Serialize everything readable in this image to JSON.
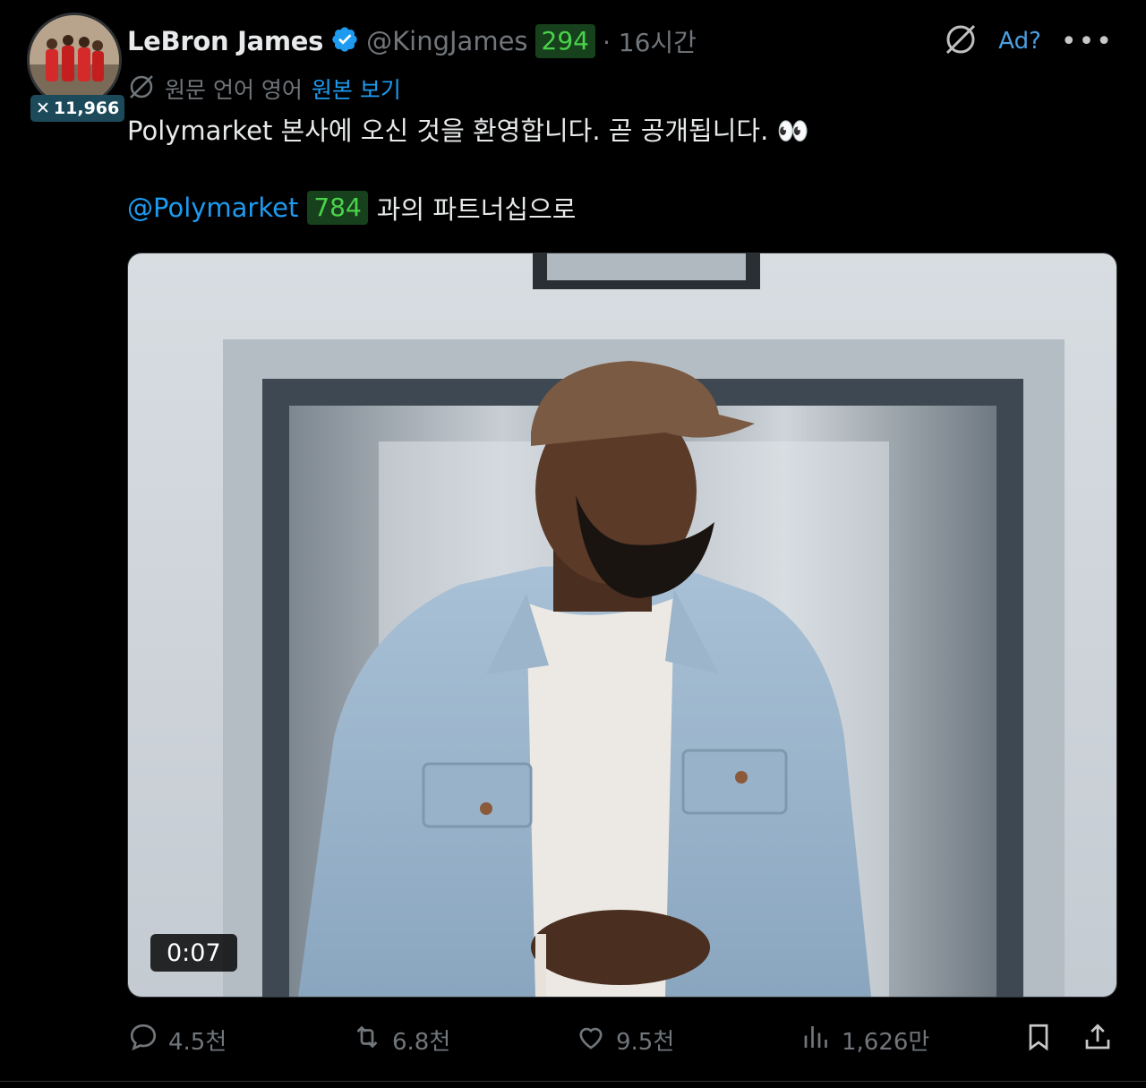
{
  "author": {
    "name": "LeBron James",
    "handle": "@KingJames",
    "handle_count": "294",
    "time": "· 16시간",
    "follower_badge": "11,966"
  },
  "header": {
    "ad_label": "Ad?",
    "more_label": "•••"
  },
  "translation": {
    "label": "원문 언어 영어",
    "link": "원본 보기"
  },
  "body": {
    "line1": "Polymarket 본사에 오신 것을 환영합니다. 곧 공개됩니다. 👀",
    "mention": "@Polymarket",
    "mention_count": "784",
    "line2_rest": "과의 파트너십으로"
  },
  "media": {
    "duration": "0:07"
  },
  "actions": {
    "replies": "4.5천",
    "reposts": "6.8천",
    "likes": "9.5천",
    "views": "1,626만"
  },
  "colors": {
    "background": "#000000",
    "text": "#e7e9ea",
    "muted": "#71767b",
    "link": "#1d9bf0",
    "count_badge_bg": "#17401c",
    "count_badge_fg": "#4ad34a"
  },
  "icons": [
    "verified-badge-icon",
    "no-sign-icon",
    "translate-icon",
    "reply-icon",
    "repost-icon",
    "like-icon",
    "views-icon",
    "bookmark-icon",
    "share-icon"
  ]
}
